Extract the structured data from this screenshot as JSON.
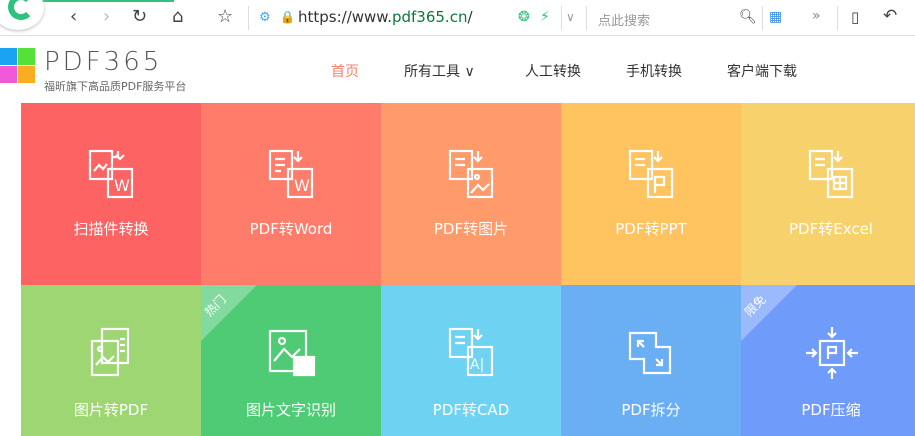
{
  "browser": {
    "url_prefix": "https://www.",
    "url_domain": "pdf365.cn",
    "url_suffix": "/",
    "search_placeholder": "点此搜索"
  },
  "site": {
    "brand": "PDF365",
    "slogan": "福昕旗下高品质PDF服务平台"
  },
  "nav": [
    {
      "label": "首页",
      "active": true
    },
    {
      "label": "所有工具 ∨"
    },
    {
      "label": "人工转换"
    },
    {
      "label": "手机转换"
    },
    {
      "label": "客户端下载"
    }
  ],
  "tiles": [
    {
      "label": "扫描件转换",
      "color": "#fe6363",
      "icon": "scan-to-word-icon"
    },
    {
      "label": "PDF转Word",
      "color": "#ff7c6a",
      "icon": "pdf-to-word-icon"
    },
    {
      "label": "PDF转图片",
      "color": "#ff9a6b",
      "icon": "pdf-to-image-icon"
    },
    {
      "label": "PDF转PPT",
      "color": "#ffc35f",
      "icon": "pdf-to-ppt-icon"
    },
    {
      "label": "PDF转Excel",
      "color": "#f7d26c",
      "icon": "pdf-to-excel-icon"
    },
    {
      "label": "图片转PDF",
      "color": "#9dd673",
      "icon": "image-to-pdf-icon"
    },
    {
      "label": "图片文字识别",
      "color": "#4ecb74",
      "icon": "ocr-icon",
      "badge": "热门"
    },
    {
      "label": "PDF转CAD",
      "color": "#6ed2f2",
      "icon": "pdf-to-cad-icon"
    },
    {
      "label": "PDF拆分",
      "color": "#6aaef4",
      "icon": "pdf-split-icon"
    },
    {
      "label": "PDF压缩",
      "color": "#6f9cfa",
      "icon": "pdf-compress-icon",
      "badge": "限免"
    }
  ]
}
